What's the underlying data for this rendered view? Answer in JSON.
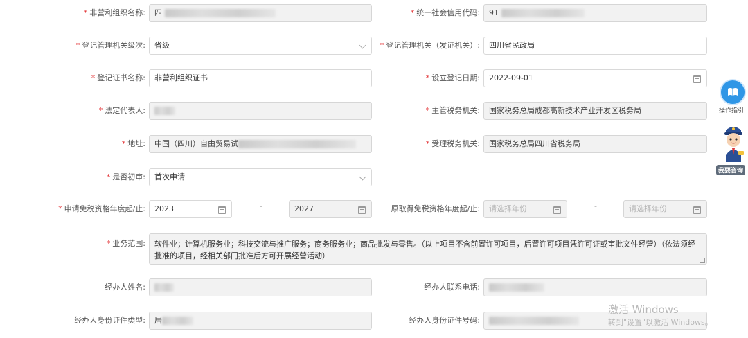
{
  "form": {
    "org_name": {
      "label": "非营利组织名称:",
      "value": "四"
    },
    "credit_code": {
      "label": "统一社会信用代码:",
      "value": "91"
    },
    "reg_level": {
      "label": "登记管理机关级次:",
      "value": "省级"
    },
    "reg_authority": {
      "label": "登记管理机关（发证机关）:",
      "value": "四川省民政局"
    },
    "cert_name": {
      "label": "登记证书名称:",
      "value": "非营利组织证书"
    },
    "reg_date": {
      "label": "设立登记日期:",
      "value": "2022-09-01"
    },
    "legal_rep": {
      "label": "法定代表人:",
      "value": ""
    },
    "tax_authority": {
      "label": "主管税务机关:",
      "value": "国家税务总局成都高新技术产业开发区税务局"
    },
    "address": {
      "label": "地址:",
      "value": "中国（四川）自由贸易试"
    },
    "accept_authority": {
      "label": "受理税务机关:",
      "value": "国家税务总局四川省税务局"
    },
    "first_review": {
      "label": "是否初审:",
      "value": "首次申请"
    },
    "apply_years": {
      "label": "申请免税资格年度起/止:",
      "start": "2023",
      "end": "2027",
      "separator": "-"
    },
    "orig_years": {
      "label": "原取得免税资格年度起/止:",
      "start_placeholder": "请选择年份",
      "end_placeholder": "请选择年份",
      "separator": "-"
    },
    "business_scope": {
      "label": "业务范围:",
      "value": "软件业；计算机服务业；科技交流与推广服务；商务服务业；商品批发与零售。（以上项目不含前置许可项目，后置许可项目凭许可证或审批文件经营）（依法须经批准的项目，经相关部门批准后方可开展经营活动）"
    },
    "agent_name": {
      "label": "经办人姓名:",
      "value": ""
    },
    "agent_phone": {
      "label": "经办人联系电话:",
      "value": ""
    },
    "agent_id_type": {
      "label": "经办人身份证件类型:",
      "value": "居"
    },
    "agent_id_no": {
      "label": "经办人身份证件号码:",
      "value": ""
    }
  },
  "required_mark": "*",
  "side": {
    "guide_label": "操作指引",
    "consult_label": "我要咨询",
    "guide_icon": "book-icon",
    "consult_icon": "tax-officer-avatar-icon"
  },
  "watermark": {
    "line1": "激活 Windows",
    "line2": "转到\"设置\"以激活 Windows。"
  },
  "colors": {
    "required": "#e4393c",
    "accent": "#2f96e6",
    "disabled_bg": "#f2f2f2"
  }
}
